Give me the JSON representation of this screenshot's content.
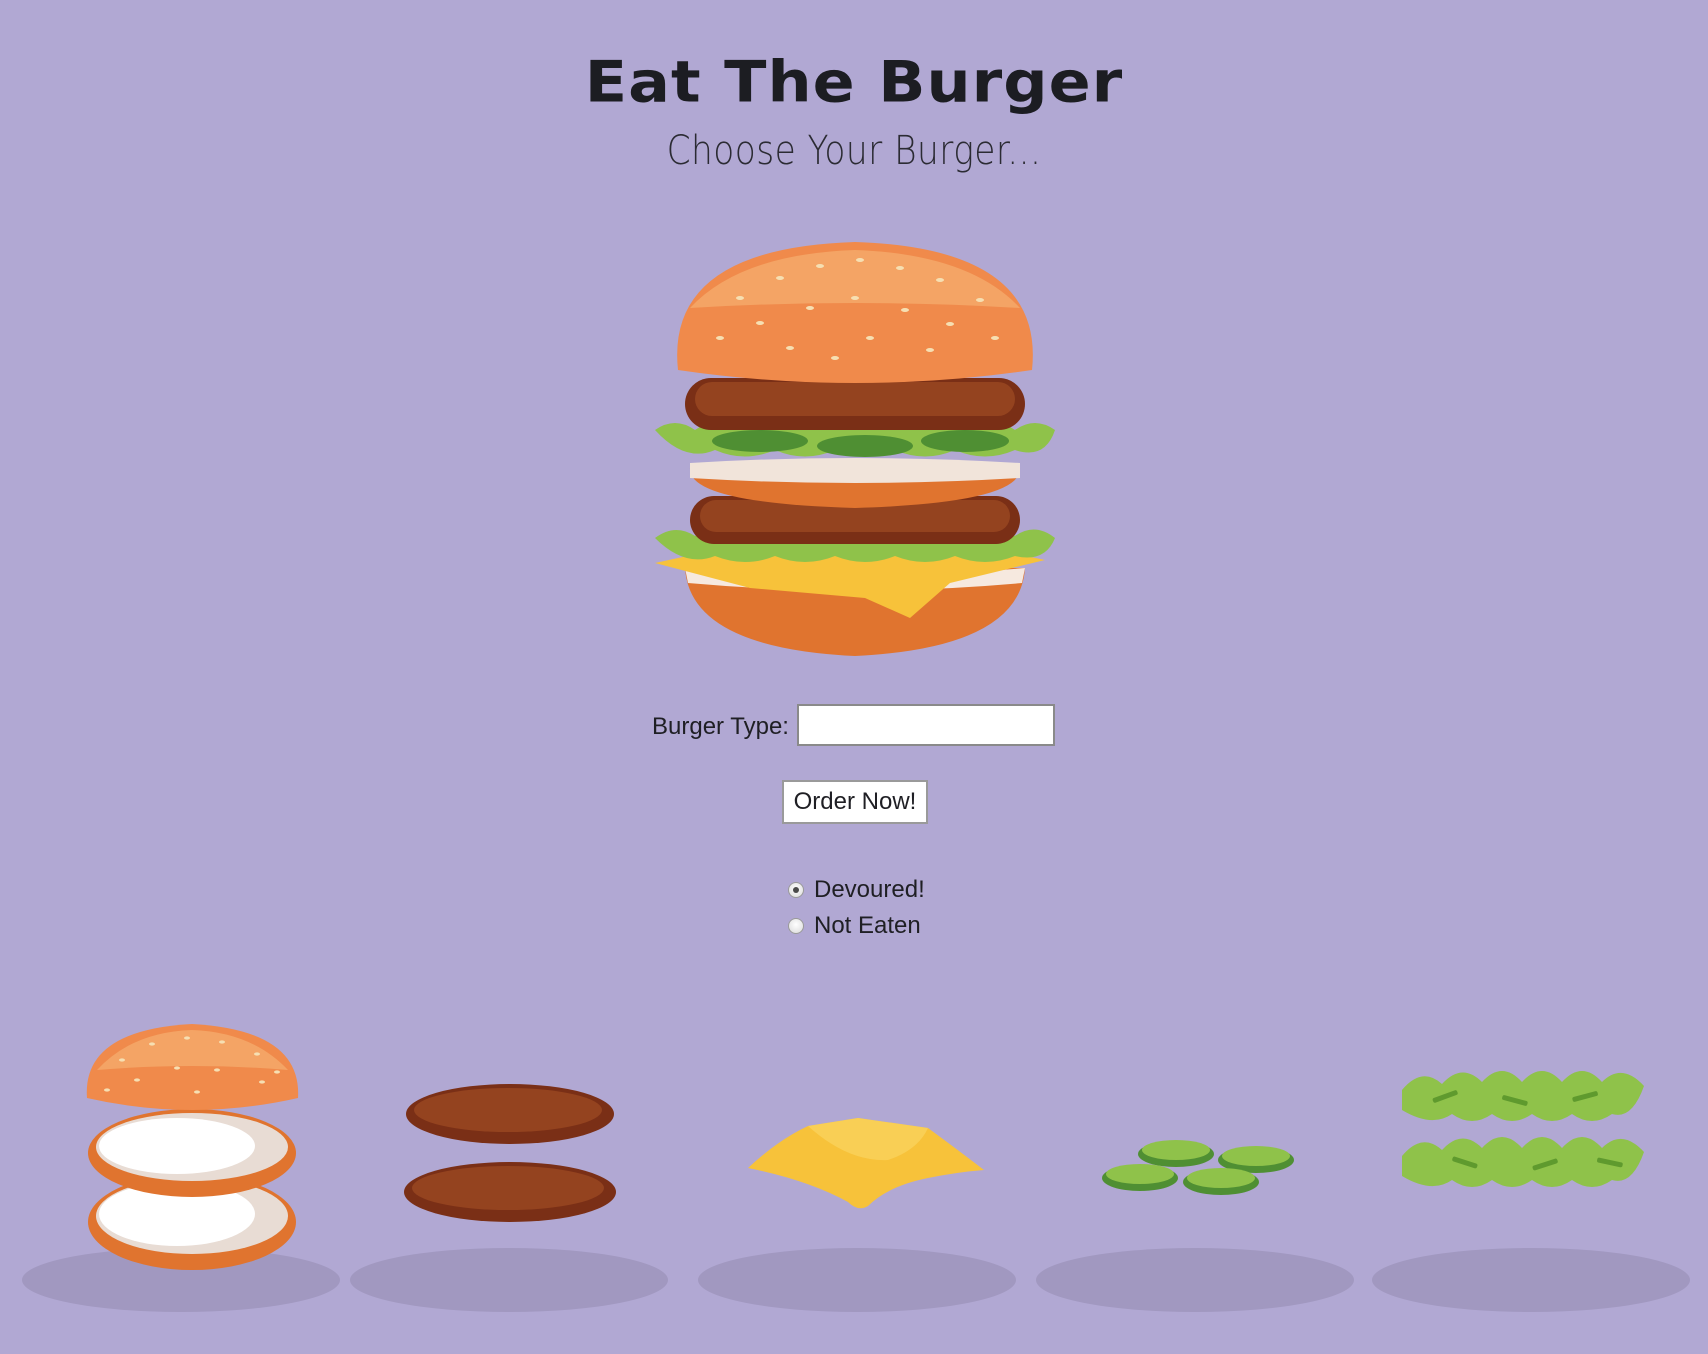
{
  "header": {
    "title": "Eat The Burger",
    "subtitle": "Choose Your Burger..."
  },
  "form": {
    "burger_type_label": "Burger Type:",
    "burger_type_value": "",
    "submit_label": "Order Now!"
  },
  "status_options": [
    {
      "label": "Devoured!",
      "selected": true
    },
    {
      "label": "Not Eaten",
      "selected": false
    }
  ],
  "ingredients": [
    {
      "name": "buns"
    },
    {
      "name": "patties"
    },
    {
      "name": "cheese"
    },
    {
      "name": "pickles"
    },
    {
      "name": "lettuce"
    }
  ],
  "colors": {
    "background": "#b1a8d3",
    "bun": "#f08a4b",
    "patty": "#8b3a1c",
    "cheese": "#f7c23a",
    "lettuce": "#8fc24a",
    "pickle": "#5aa33b"
  }
}
